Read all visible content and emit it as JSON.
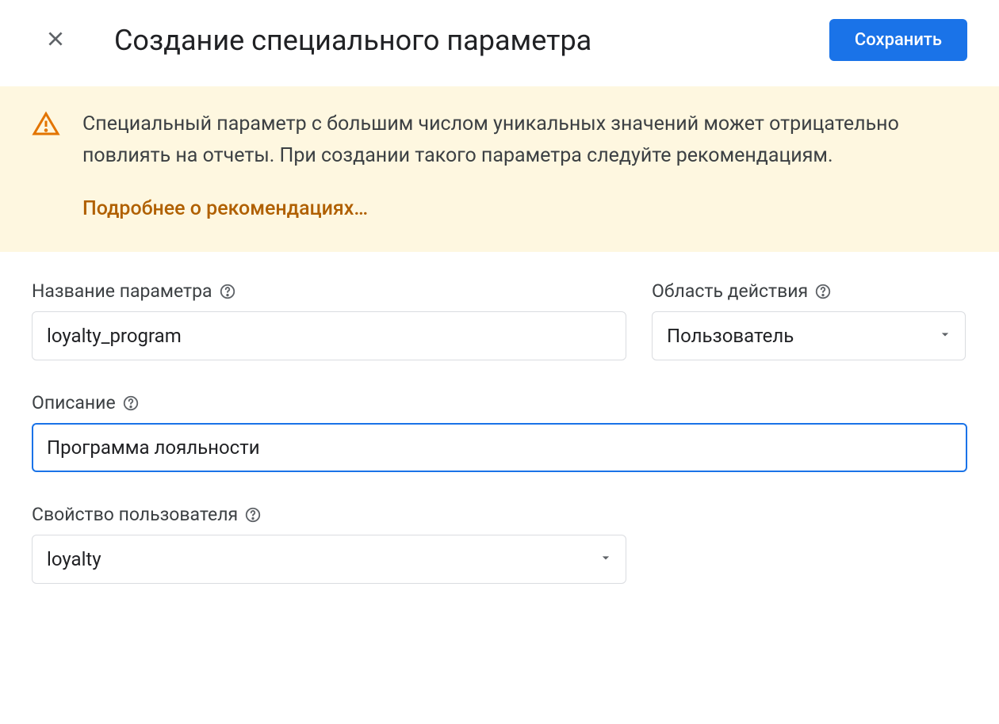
{
  "header": {
    "title": "Создание специального параметра",
    "save_label": "Сохранить"
  },
  "warning": {
    "text": "Специальный параметр с большим числом уникальных значений может отрицательно повлиять на отчеты. При создании такого параметра следуйте рекомендациям.",
    "link": "Подробнее о рекомендациях…"
  },
  "form": {
    "name_label": "Название параметра",
    "name_value": "loyalty_program",
    "scope_label": "Область действия",
    "scope_value": "Пользователь",
    "description_label": "Описание",
    "description_value": "Программа лояльности",
    "user_property_label": "Свойство пользователя",
    "user_property_value": "loyalty"
  }
}
